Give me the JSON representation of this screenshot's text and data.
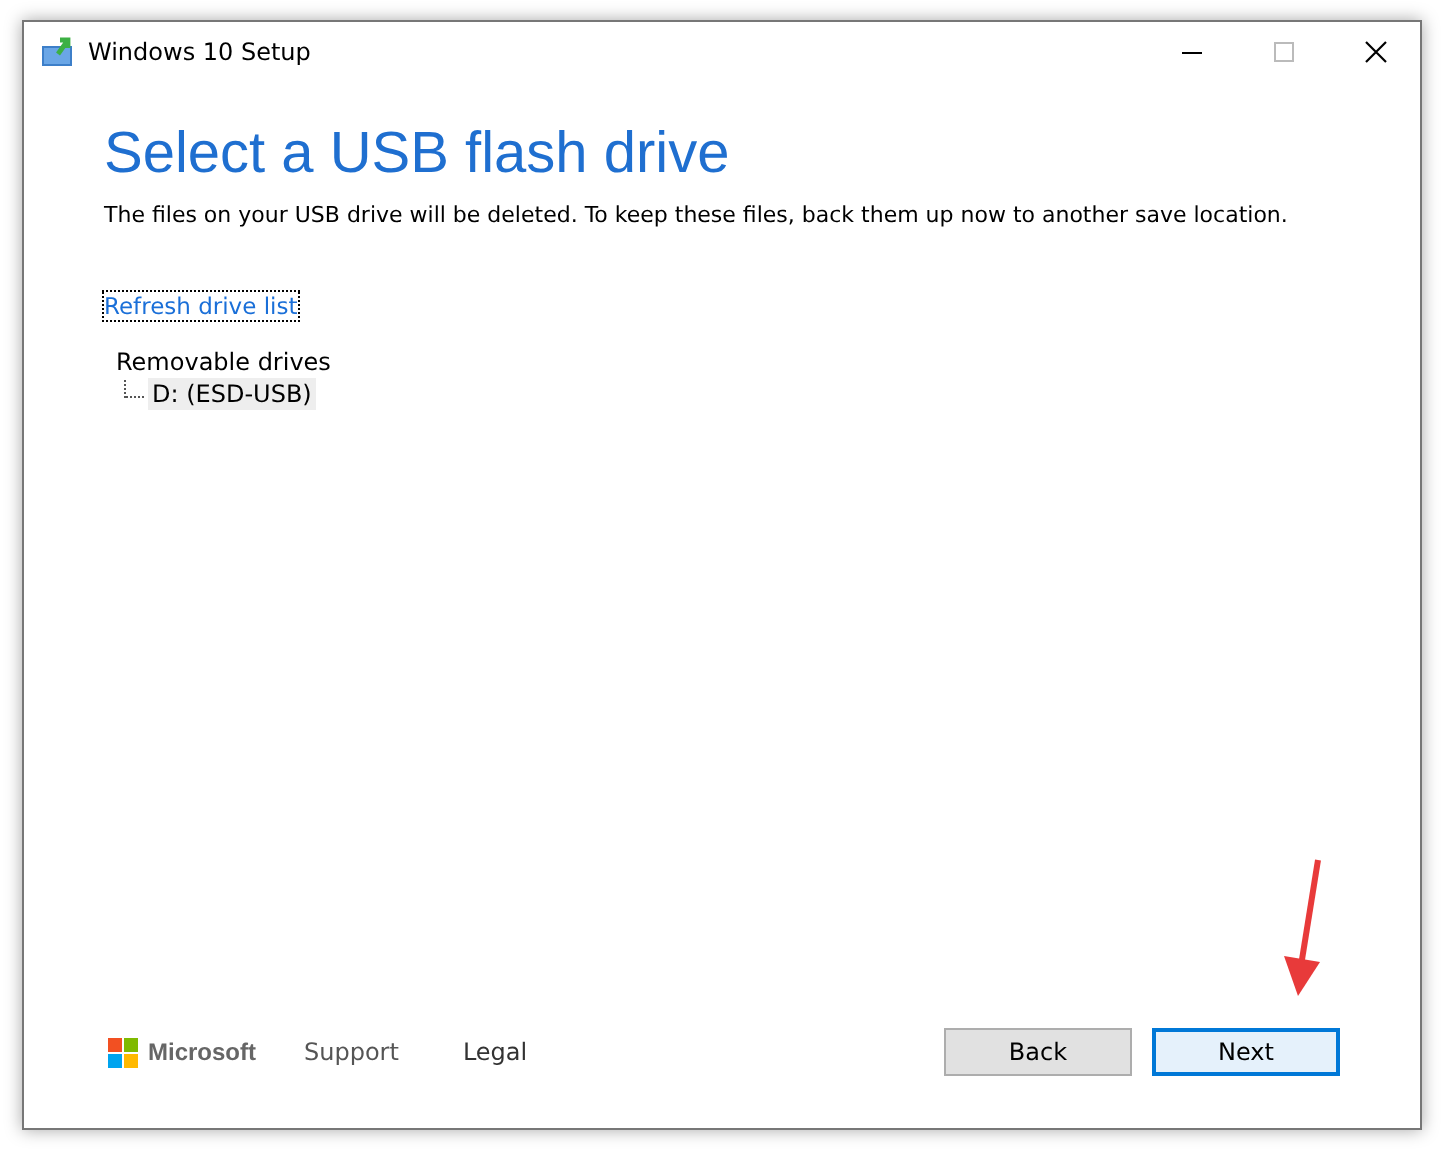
{
  "window": {
    "title": "Windows 10 Setup"
  },
  "heading": "Select a USB flash drive",
  "description": "The files on your USB drive will be deleted. To keep these files, back them up now to another save location.",
  "refresh_link": "Refresh drive list",
  "drive_tree": [
    {
      "label": "Removable drives",
      "selected": false,
      "children": [
        {
          "label": "D: (ESD-USB)",
          "selected": true
        }
      ]
    }
  ],
  "footer": {
    "brand": "Microsoft",
    "links": [
      "Support",
      "Legal"
    ]
  },
  "buttons": [
    {
      "label": "Back",
      "kind": "secondary"
    },
    {
      "label": "Next",
      "kind": "default"
    }
  ]
}
